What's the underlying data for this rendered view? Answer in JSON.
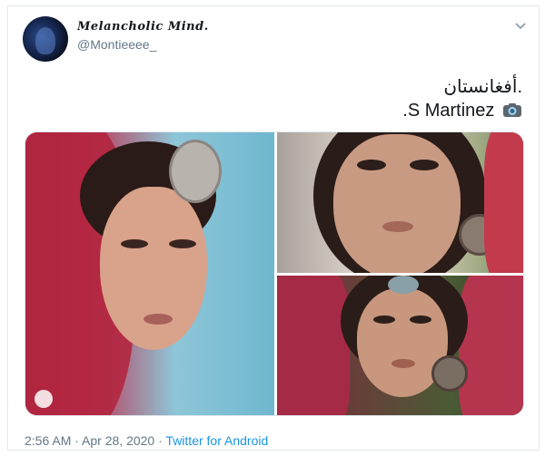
{
  "author": {
    "display_name": "Melancholic Mind.",
    "handle": "@Montieeee_"
  },
  "tweet": {
    "text_line1": "أفغانستان.",
    "text_line2": ".S Martinez",
    "camera_icon": "camera-icon"
  },
  "media": {
    "photos": [
      {
        "icon": "photo"
      },
      {
        "icon": "photo"
      },
      {
        "icon": "photo"
      }
    ]
  },
  "meta": {
    "time": "2:56 AM",
    "separator1": " · ",
    "date": "Apr 28, 2020",
    "separator2": " · ",
    "source": "Twitter for Android"
  },
  "colors": {
    "link": "#1b95e0",
    "secondary_text": "#657786",
    "border": "#e1e8ed"
  }
}
